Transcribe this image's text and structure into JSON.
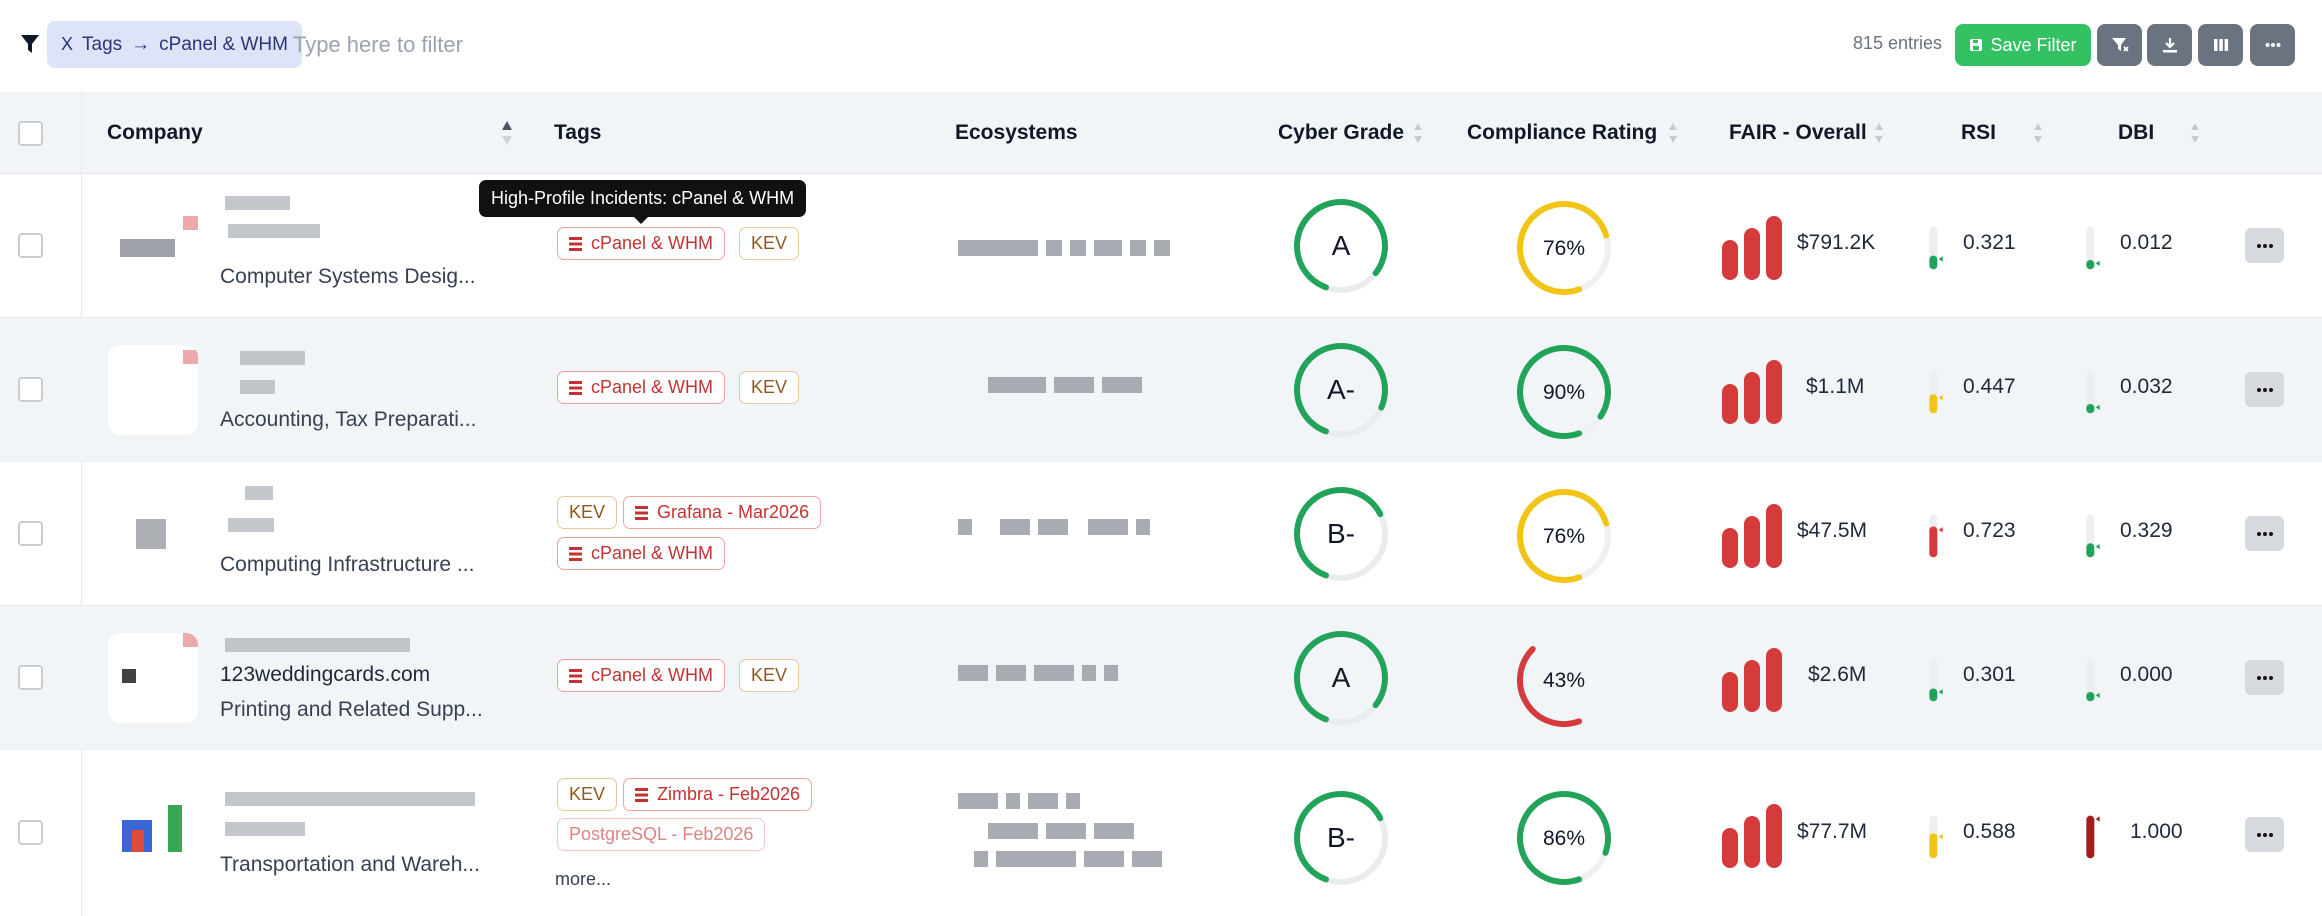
{
  "toolbar": {
    "chip_remove": "X",
    "chip_field": "Tags",
    "chip_arrow": "→",
    "chip_value": "cPanel & WHM",
    "filter_placeholder": "Type here to filter",
    "entries": "815 entries",
    "save_label": "Save Filter"
  },
  "columns": {
    "company": "Company",
    "tags": "Tags",
    "ecosystems": "Ecosystems",
    "cyber_grade": "Cyber Grade",
    "compliance": "Compliance Rating",
    "fair": "FAIR - Overall",
    "rsi": "RSI",
    "dbi": "DBI"
  },
  "tooltip": "High-Profile Incidents: cPanel & WHM",
  "more_label": "more...",
  "rows": [
    {
      "company_name": "",
      "industry": "Computer Systems Desig...",
      "tag1": "cPanel & WHM",
      "tag2": "KEV",
      "tag3": "",
      "tag4": "",
      "grade": "A",
      "grade_fraction": 0.8,
      "compliance": "76%",
      "compliance_fraction": 0.76,
      "fair": "$791.2K",
      "rsi": "0.321",
      "rsi_fraction": 0.321,
      "dbi": "0.012",
      "dbi_fraction": 0.012
    },
    {
      "company_name": "",
      "industry": "Accounting, Tax Preparati...",
      "tag1": "cPanel & WHM",
      "tag2": "KEV",
      "tag3": "",
      "tag4": "",
      "grade": "A-",
      "grade_fraction": 0.76,
      "compliance": "90%",
      "compliance_fraction": 0.9,
      "fair": "$1.1M",
      "rsi": "0.447",
      "rsi_fraction": 0.447,
      "dbi": "0.032",
      "dbi_fraction": 0.032
    },
    {
      "company_name": "",
      "industry": "Computing Infrastructure ...",
      "tag1": "KEV",
      "tag2": "Grafana - Mar2026",
      "tag3": "cPanel & WHM",
      "tag4": "",
      "grade": "B-",
      "grade_fraction": 0.62,
      "compliance": "76%",
      "compliance_fraction": 0.76,
      "fair": "$47.5M",
      "rsi": "0.723",
      "rsi_fraction": 0.723,
      "dbi": "0.329",
      "dbi_fraction": 0.329
    },
    {
      "company_name": "123weddingcards.com",
      "industry": "Printing and Related Supp...",
      "tag1": "cPanel & WHM",
      "tag2": "KEV",
      "tag3": "",
      "tag4": "",
      "grade": "A",
      "grade_fraction": 0.8,
      "compliance": "43%",
      "compliance_fraction": 0.43,
      "fair": "$2.6M",
      "rsi": "0.301",
      "rsi_fraction": 0.301,
      "dbi": "0.000",
      "dbi_fraction": 0.0
    },
    {
      "company_name": "",
      "industry": "Transportation and Wareh...",
      "tag1": "KEV",
      "tag2": "Zimbra - Feb2026",
      "tag3": "PostgreSQL - Feb2026",
      "tag4": "",
      "grade": "B-",
      "grade_fraction": 0.62,
      "compliance": "86%",
      "compliance_fraction": 0.86,
      "fair": "$77.7M",
      "rsi": "0.588",
      "rsi_fraction": 0.588,
      "dbi": "1.000",
      "dbi_fraction": 1.0
    }
  ],
  "colors": {
    "green": "#22a35a",
    "yellow": "#f2c416",
    "red": "#d63b3b",
    "dark_red": "#a11d1d",
    "save": "#34c163",
    "chip_bg": "#dfe3f7"
  }
}
